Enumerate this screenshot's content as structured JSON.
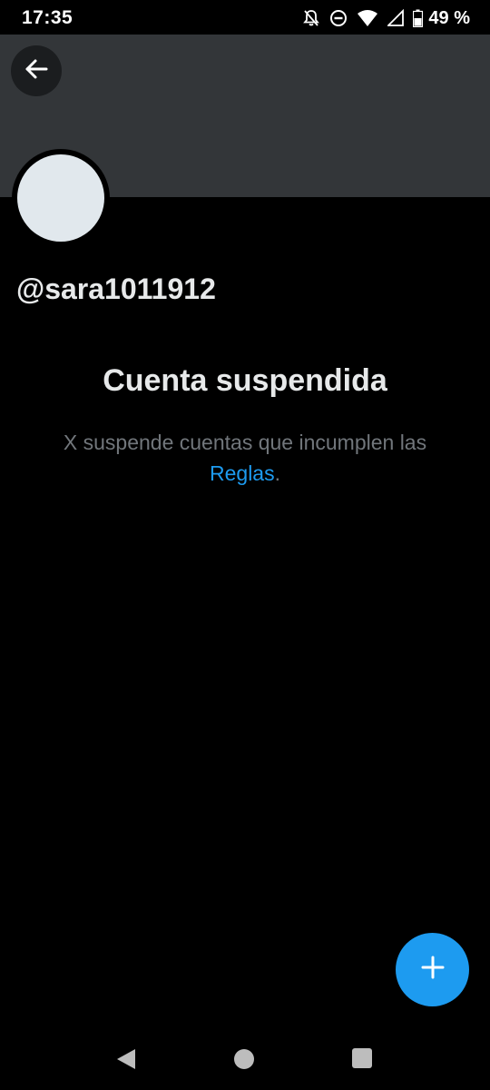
{
  "status_bar": {
    "time": "17:35",
    "battery": "49 %",
    "icons": [
      "notifications-off-icon",
      "do-not-disturb-icon",
      "wifi-icon",
      "signal-icon",
      "battery-icon"
    ]
  },
  "header": {
    "back_icon": "arrow-left-icon"
  },
  "profile": {
    "handle": "@sara1011912"
  },
  "suspension": {
    "title": "Cuenta suspendida",
    "message": "X suspende cuentas que incumplen las",
    "link_text": "Reglas",
    "trailing": "."
  },
  "fab": {
    "icon": "plus-icon"
  },
  "nav_bar": {
    "icons": [
      "nav-back-icon",
      "nav-home-icon",
      "nav-recents-icon"
    ]
  },
  "colors": {
    "background": "#000000",
    "banner": "#333639",
    "accent": "#1d9bf0",
    "muted_text": "#71767b",
    "primary_text": "#e7e9ea"
  }
}
